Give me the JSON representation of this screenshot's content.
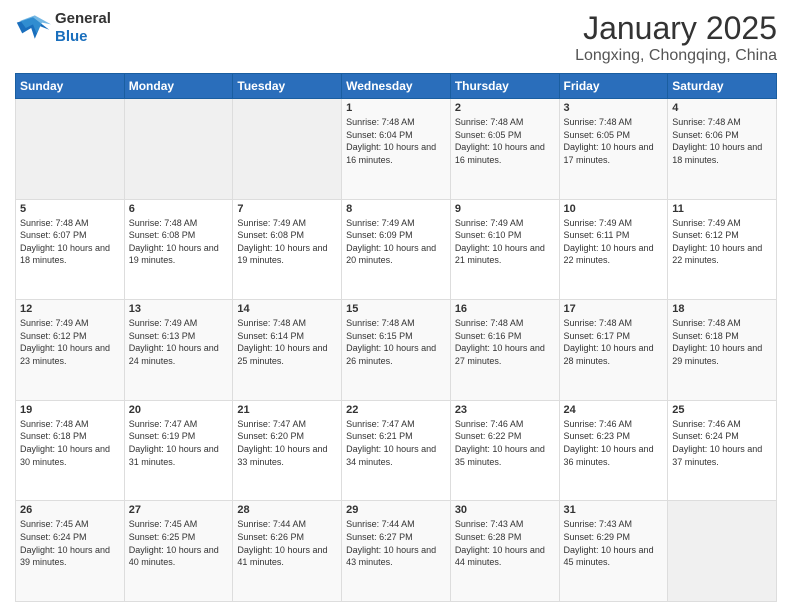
{
  "header": {
    "logo_line1": "General",
    "logo_line2": "Blue",
    "title": "January 2025",
    "subtitle": "Longxing, Chongqing, China"
  },
  "days_of_week": [
    "Sunday",
    "Monday",
    "Tuesday",
    "Wednesday",
    "Thursday",
    "Friday",
    "Saturday"
  ],
  "weeks": [
    [
      {
        "day": "",
        "empty": true
      },
      {
        "day": "",
        "empty": true
      },
      {
        "day": "",
        "empty": true
      },
      {
        "day": "1",
        "sunrise": "7:48 AM",
        "sunset": "6:04 PM",
        "daylight": "10 hours and 16 minutes."
      },
      {
        "day": "2",
        "sunrise": "7:48 AM",
        "sunset": "6:05 PM",
        "daylight": "10 hours and 16 minutes."
      },
      {
        "day": "3",
        "sunrise": "7:48 AM",
        "sunset": "6:05 PM",
        "daylight": "10 hours and 17 minutes."
      },
      {
        "day": "4",
        "sunrise": "7:48 AM",
        "sunset": "6:06 PM",
        "daylight": "10 hours and 18 minutes."
      }
    ],
    [
      {
        "day": "5",
        "sunrise": "7:48 AM",
        "sunset": "6:07 PM",
        "daylight": "10 hours and 18 minutes."
      },
      {
        "day": "6",
        "sunrise": "7:48 AM",
        "sunset": "6:08 PM",
        "daylight": "10 hours and 19 minutes."
      },
      {
        "day": "7",
        "sunrise": "7:49 AM",
        "sunset": "6:08 PM",
        "daylight": "10 hours and 19 minutes."
      },
      {
        "day": "8",
        "sunrise": "7:49 AM",
        "sunset": "6:09 PM",
        "daylight": "10 hours and 20 minutes."
      },
      {
        "day": "9",
        "sunrise": "7:49 AM",
        "sunset": "6:10 PM",
        "daylight": "10 hours and 21 minutes."
      },
      {
        "day": "10",
        "sunrise": "7:49 AM",
        "sunset": "6:11 PM",
        "daylight": "10 hours and 22 minutes."
      },
      {
        "day": "11",
        "sunrise": "7:49 AM",
        "sunset": "6:12 PM",
        "daylight": "10 hours and 22 minutes."
      }
    ],
    [
      {
        "day": "12",
        "sunrise": "7:49 AM",
        "sunset": "6:12 PM",
        "daylight": "10 hours and 23 minutes."
      },
      {
        "day": "13",
        "sunrise": "7:49 AM",
        "sunset": "6:13 PM",
        "daylight": "10 hours and 24 minutes."
      },
      {
        "day": "14",
        "sunrise": "7:48 AM",
        "sunset": "6:14 PM",
        "daylight": "10 hours and 25 minutes."
      },
      {
        "day": "15",
        "sunrise": "7:48 AM",
        "sunset": "6:15 PM",
        "daylight": "10 hours and 26 minutes."
      },
      {
        "day": "16",
        "sunrise": "7:48 AM",
        "sunset": "6:16 PM",
        "daylight": "10 hours and 27 minutes."
      },
      {
        "day": "17",
        "sunrise": "7:48 AM",
        "sunset": "6:17 PM",
        "daylight": "10 hours and 28 minutes."
      },
      {
        "day": "18",
        "sunrise": "7:48 AM",
        "sunset": "6:18 PM",
        "daylight": "10 hours and 29 minutes."
      }
    ],
    [
      {
        "day": "19",
        "sunrise": "7:48 AM",
        "sunset": "6:18 PM",
        "daylight": "10 hours and 30 minutes."
      },
      {
        "day": "20",
        "sunrise": "7:47 AM",
        "sunset": "6:19 PM",
        "daylight": "10 hours and 31 minutes."
      },
      {
        "day": "21",
        "sunrise": "7:47 AM",
        "sunset": "6:20 PM",
        "daylight": "10 hours and 33 minutes."
      },
      {
        "day": "22",
        "sunrise": "7:47 AM",
        "sunset": "6:21 PM",
        "daylight": "10 hours and 34 minutes."
      },
      {
        "day": "23",
        "sunrise": "7:46 AM",
        "sunset": "6:22 PM",
        "daylight": "10 hours and 35 minutes."
      },
      {
        "day": "24",
        "sunrise": "7:46 AM",
        "sunset": "6:23 PM",
        "daylight": "10 hours and 36 minutes."
      },
      {
        "day": "25",
        "sunrise": "7:46 AM",
        "sunset": "6:24 PM",
        "daylight": "10 hours and 37 minutes."
      }
    ],
    [
      {
        "day": "26",
        "sunrise": "7:45 AM",
        "sunset": "6:24 PM",
        "daylight": "10 hours and 39 minutes."
      },
      {
        "day": "27",
        "sunrise": "7:45 AM",
        "sunset": "6:25 PM",
        "daylight": "10 hours and 40 minutes."
      },
      {
        "day": "28",
        "sunrise": "7:44 AM",
        "sunset": "6:26 PM",
        "daylight": "10 hours and 41 minutes."
      },
      {
        "day": "29",
        "sunrise": "7:44 AM",
        "sunset": "6:27 PM",
        "daylight": "10 hours and 43 minutes."
      },
      {
        "day": "30",
        "sunrise": "7:43 AM",
        "sunset": "6:28 PM",
        "daylight": "10 hours and 44 minutes."
      },
      {
        "day": "31",
        "sunrise": "7:43 AM",
        "sunset": "6:29 PM",
        "daylight": "10 hours and 45 minutes."
      },
      {
        "day": "",
        "empty": true
      }
    ]
  ],
  "labels": {
    "sunrise": "Sunrise:",
    "sunset": "Sunset:",
    "daylight": "Daylight:"
  }
}
